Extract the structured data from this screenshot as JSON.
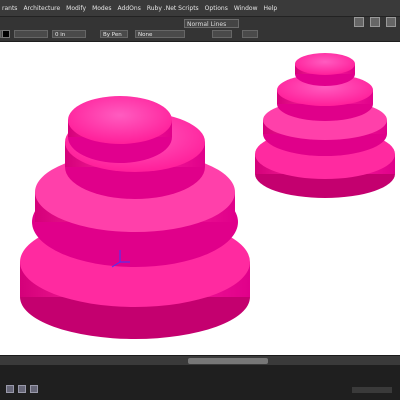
{
  "menu": {
    "items": [
      "rants",
      "Architecture",
      "Modify",
      "Modes",
      "AddOns",
      "Ruby .Net Scripts",
      "Options",
      "Window",
      "Help"
    ]
  },
  "toolbar": {
    "line_style": "Normal Lines",
    "thickness": "0 in",
    "layer": "By Pen",
    "fill": "None"
  },
  "scene": {
    "shape_color": "#ff1493",
    "shape_light": "#ff66c4",
    "shape_dark": "#c2006e",
    "axis_color": "#3a3aff"
  },
  "icons": {
    "window_close": "close-icon"
  }
}
